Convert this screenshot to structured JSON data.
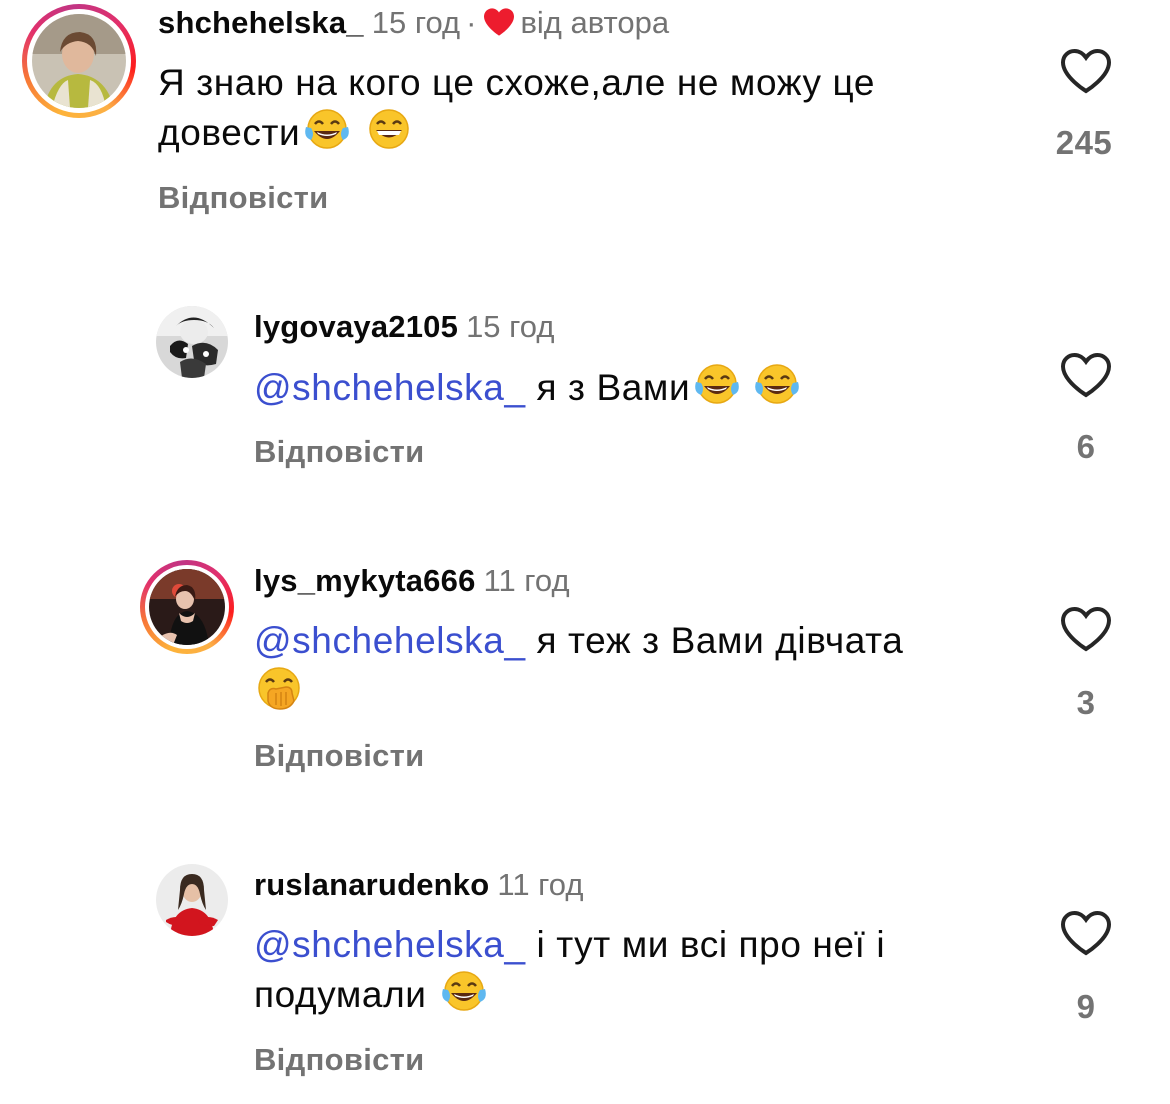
{
  "comments": [
    {
      "username": "shchehelska_",
      "time": "15 год",
      "separator": "·",
      "author_badge": "від автора",
      "text_plain": "Я знаю на кого це схоже,але не можу це довести",
      "mention": "",
      "reply_label": "Відповісти",
      "like_count": "245",
      "emojis": [
        "face-with-tears-of-joy",
        "grinning-face-with-smiling-eyes"
      ]
    },
    {
      "username": "lygovaya2105",
      "time": "15 год",
      "mention": "@shchehelska_",
      "text_plain": "я з Вами",
      "reply_label": "Відповісти",
      "like_count": "6",
      "emojis": [
        "face-with-tears-of-joy",
        "face-with-tears-of-joy"
      ]
    },
    {
      "username": "lys_mykyta666",
      "time": "11 год",
      "mention": "@shchehelska_",
      "text_plain": "я теж з Вами дівчата",
      "reply_label": "Відповісти",
      "like_count": "3",
      "emojis": [
        "face-with-hand-over-mouth"
      ]
    },
    {
      "username": "ruslanarudenko",
      "time": "11 год",
      "mention": "@shchehelska_",
      "text_plain": "і тут ми всі про неї і подумали",
      "reply_label": "Відповісти",
      "like_count": "9",
      "emojis": [
        "face-with-tears-of-joy"
      ]
    }
  ],
  "colors": {
    "mention": "#3b4fcf",
    "secondary_text": "#737373",
    "author_heart": "#ed1c2e",
    "story_ring": [
      "#fdb33a",
      "#e1306c",
      "#c13584"
    ]
  },
  "icons": {
    "like": "heart-outline-icon",
    "author_like": "heart-filled-icon"
  }
}
